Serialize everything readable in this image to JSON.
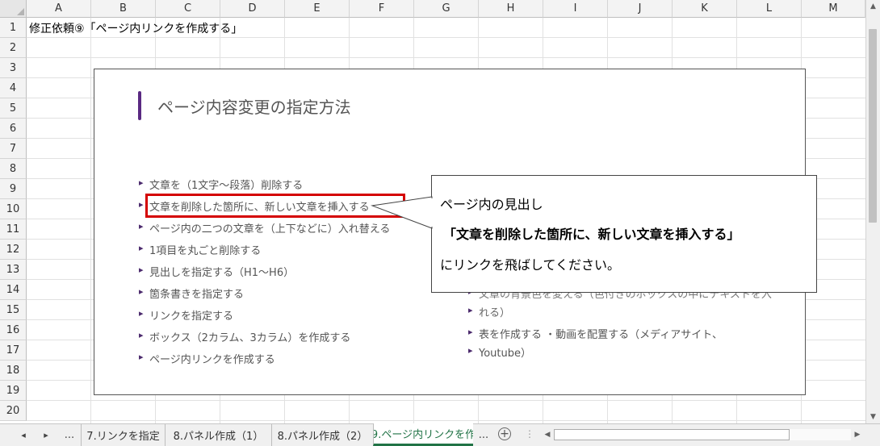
{
  "sheet": {
    "columns": [
      "A",
      "B",
      "C",
      "D",
      "E",
      "F",
      "G",
      "H",
      "I",
      "J",
      "K",
      "L",
      "M"
    ],
    "rows": [
      "1",
      "2",
      "3",
      "4",
      "5",
      "6",
      "7",
      "8",
      "9",
      "10",
      "11",
      "12",
      "13",
      "14",
      "15",
      "16",
      "17",
      "18",
      "19",
      "20"
    ],
    "cell_a1": "修正依頼⑨「ページ内リンクを作成する」"
  },
  "slide": {
    "title": "ページ内容変更の指定方法",
    "left_items": [
      "文章を（1文字～段落）削除する",
      "文章を削除した箇所に、新しい文章を挿入する",
      "ページ内の二つの文章を（上下などに）入れ替える",
      "1項目を丸ごと削除する",
      "見出しを指定する（H1～H6）",
      "箇条書きを指定する",
      "リンクを指定する",
      "ボックス（2カラム、3カラム）を作成する",
      "ページ内リンクを作成する"
    ],
    "right_items": [
      "文章の背景色を変える（色付きのボックスの中にテキストを入",
      "れる）",
      "表を作成する ・動画を配置する（メディアサイト、",
      "Youtube）"
    ]
  },
  "callout": {
    "line1": "ページ内の見出し",
    "line2": "「文章を削除した箇所に、新しい文章を挿入する」",
    "line3": "にリンクを飛ばしてください。"
  },
  "tabs": {
    "nav_prev": "◂",
    "nav_next": "▸",
    "ellipsis_left": "...",
    "items": [
      "7.リンクを指定",
      "8.パネル作成（1）",
      "8.パネル作成（2）",
      "9.ページ内リンクを作"
    ],
    "ellipsis_right": "...",
    "add": "+",
    "more": "⋮"
  },
  "colors": {
    "accent_purple": "#5a2a82",
    "highlight_red": "#d40000",
    "active_tab_green": "#217346"
  }
}
